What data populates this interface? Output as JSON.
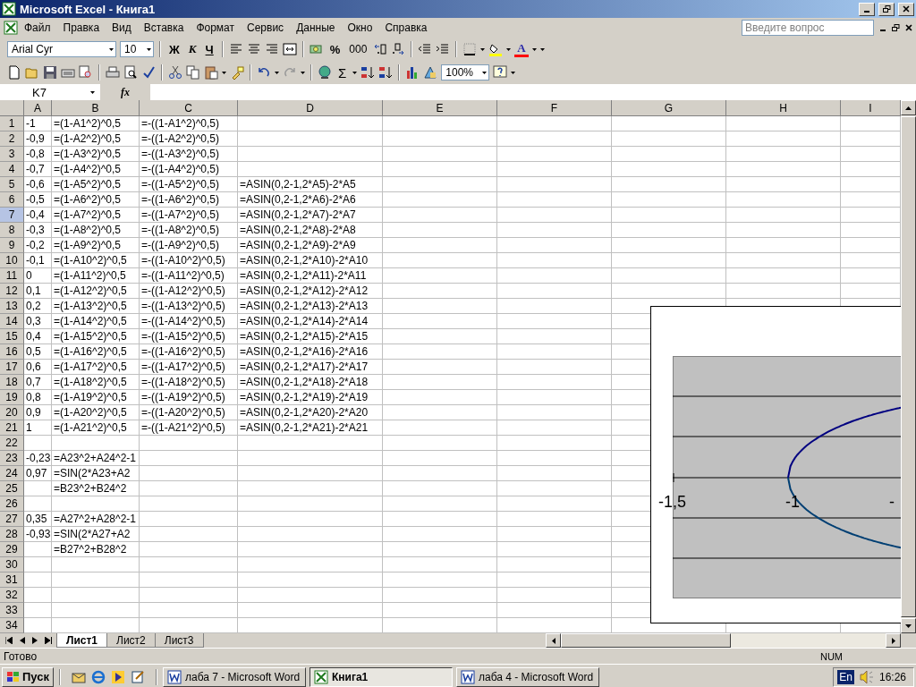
{
  "window": {
    "title": "Microsoft Excel - Книга1"
  },
  "menu": [
    "Файл",
    "Правка",
    "Вид",
    "Вставка",
    "Формат",
    "Сервис",
    "Данные",
    "Окно",
    "Справка"
  ],
  "help_box": {
    "placeholder": "Введите вопрос"
  },
  "formatting_toolbar": {
    "font": "Arial Cyr",
    "size": "10",
    "bold": "Ж",
    "italic": "К",
    "underline": "Ч",
    "percent": "%",
    "thousands": "000",
    "font_color": "A"
  },
  "standard_toolbar": {
    "autosum": "Σ",
    "zoom": "100%"
  },
  "formula_bar": {
    "name_box": "K7",
    "fx": "fx"
  },
  "columns": [
    "A",
    "B",
    "C",
    "D",
    "E",
    "F",
    "G",
    "H",
    "I"
  ],
  "rows": [
    {
      "number": "1",
      "selected": false,
      "cells": {
        "A": "-1",
        "B": "=(1-A1^2)^0,5",
        "C": "=-((1-A1^2)^0,5)"
      }
    },
    {
      "number": "2",
      "selected": false,
      "cells": {
        "A": "-0,9",
        "B": "=(1-A2^2)^0,5",
        "C": "=-((1-A2^2)^0,5)"
      }
    },
    {
      "number": "3",
      "selected": false,
      "cells": {
        "A": "-0,8",
        "B": "=(1-A3^2)^0,5",
        "C": "=-((1-A3^2)^0,5)"
      }
    },
    {
      "number": "4",
      "selected": false,
      "cells": {
        "A": "-0,7",
        "B": "=(1-A4^2)^0,5",
        "C": "=-((1-A4^2)^0,5)"
      }
    },
    {
      "number": "5",
      "selected": false,
      "cells": {
        "A": "-0,6",
        "B": "=(1-A5^2)^0,5",
        "C": "=-((1-A5^2)^0,5)",
        "D": "=ASIN(0,2-1,2*A5)-2*A5"
      }
    },
    {
      "number": "6",
      "selected": false,
      "cells": {
        "A": "-0,5",
        "B": "=(1-A6^2)^0,5",
        "C": "=-((1-A6^2)^0,5)",
        "D": "=ASIN(0,2-1,2*A6)-2*A6"
      }
    },
    {
      "number": "7",
      "selected": true,
      "cells": {
        "A": "-0,4",
        "B": "=(1-A7^2)^0,5",
        "C": "=-((1-A7^2)^0,5)",
        "D": "=ASIN(0,2-1,2*A7)-2*A7"
      }
    },
    {
      "number": "8",
      "selected": false,
      "cells": {
        "A": "-0,3",
        "B": "=(1-A8^2)^0,5",
        "C": "=-((1-A8^2)^0,5)",
        "D": "=ASIN(0,2-1,2*A8)-2*A8"
      }
    },
    {
      "number": "9",
      "selected": false,
      "cells": {
        "A": "-0,2",
        "B": "=(1-A9^2)^0,5",
        "C": "=-((1-A9^2)^0,5)",
        "D": "=ASIN(0,2-1,2*A9)-2*A9"
      }
    },
    {
      "number": "10",
      "selected": false,
      "cells": {
        "A": "-0,1",
        "B": "=(1-A10^2)^0,5",
        "C": "=-((1-A10^2)^0,5)",
        "D": "=ASIN(0,2-1,2*A10)-2*A10"
      }
    },
    {
      "number": "11",
      "selected": false,
      "cells": {
        "A": "0",
        "B": "=(1-A11^2)^0,5",
        "C": "=-((1-A11^2)^0,5)",
        "D": "=ASIN(0,2-1,2*A11)-2*A11"
      }
    },
    {
      "number": "12",
      "selected": false,
      "cells": {
        "A": "0,1",
        "B": "=(1-A12^2)^0,5",
        "C": "=-((1-A12^2)^0,5)",
        "D": "=ASIN(0,2-1,2*A12)-2*A12"
      }
    },
    {
      "number": "13",
      "selected": false,
      "cells": {
        "A": "0,2",
        "B": "=(1-A13^2)^0,5",
        "C": "=-((1-A13^2)^0,5)",
        "D": "=ASIN(0,2-1,2*A13)-2*A13"
      }
    },
    {
      "number": "14",
      "selected": false,
      "cells": {
        "A": "0,3",
        "B": "=(1-A14^2)^0,5",
        "C": "=-((1-A14^2)^0,5)",
        "D": "=ASIN(0,2-1,2*A14)-2*A14"
      }
    },
    {
      "number": "15",
      "selected": false,
      "cells": {
        "A": "0,4",
        "B": "=(1-A15^2)^0,5",
        "C": "=-((1-A15^2)^0,5)",
        "D": "=ASIN(0,2-1,2*A15)-2*A15"
      }
    },
    {
      "number": "16",
      "selected": false,
      "cells": {
        "A": "0,5",
        "B": "=(1-A16^2)^0,5",
        "C": "=-((1-A16^2)^0,5)",
        "D": "=ASIN(0,2-1,2*A16)-2*A16"
      }
    },
    {
      "number": "17",
      "selected": false,
      "cells": {
        "A": "0,6",
        "B": "=(1-A17^2)^0,5",
        "C": "=-((1-A17^2)^0,5)",
        "D": "=ASIN(0,2-1,2*A17)-2*A17"
      }
    },
    {
      "number": "18",
      "selected": false,
      "cells": {
        "A": "0,7",
        "B": "=(1-A18^2)^0,5",
        "C": "=-((1-A18^2)^0,5)",
        "D": "=ASIN(0,2-1,2*A18)-2*A18"
      }
    },
    {
      "number": "19",
      "selected": false,
      "cells": {
        "A": "0,8",
        "B": "=(1-A19^2)^0,5",
        "C": "=-((1-A19^2)^0,5)",
        "D": "=ASIN(0,2-1,2*A19)-2*A19"
      }
    },
    {
      "number": "20",
      "selected": false,
      "cells": {
        "A": "0,9",
        "B": "=(1-A20^2)^0,5",
        "C": "=-((1-A20^2)^0,5)",
        "D": "=ASIN(0,2-1,2*A20)-2*A20"
      }
    },
    {
      "number": "21",
      "selected": false,
      "cells": {
        "A": "1",
        "B": "=(1-A21^2)^0,5",
        "C": "=-((1-A21^2)^0,5)",
        "D": "=ASIN(0,2-1,2*A21)-2*A21"
      }
    },
    {
      "number": "22",
      "selected": false
    },
    {
      "number": "23",
      "selected": false,
      "cells": {
        "A": "-0,23",
        "B": "=A23^2+A24^2-1"
      }
    },
    {
      "number": "24",
      "selected": false,
      "cells": {
        "A": "0,97",
        "B": "=SIN(2*A23+A2"
      }
    },
    {
      "number": "25",
      "selected": false,
      "cells": {
        "B": "=B23^2+B24^2"
      }
    },
    {
      "number": "26",
      "selected": false
    },
    {
      "number": "27",
      "selected": false,
      "cells": {
        "A": "0,35",
        "B": "=A27^2+A28^2-1"
      }
    },
    {
      "number": "28",
      "selected": false,
      "cells": {
        "A": "-0,93",
        "B": "=SIN(2*A27+A2"
      }
    },
    {
      "number": "29",
      "selected": false,
      "cells": {
        "B": "=B27^2+B28^2"
      }
    },
    {
      "number": "30",
      "selected": false
    },
    {
      "number": "31",
      "selected": false
    },
    {
      "number": "32",
      "selected": false
    },
    {
      "number": "33",
      "selected": false
    },
    {
      "number": "34",
      "selected": false
    }
  ],
  "chart": {
    "x_axis_labels": [
      "-1,5",
      "-1",
      "-"
    ]
  },
  "sheet_tabs": [
    {
      "label": "Лист1",
      "selected": true
    },
    {
      "label": "Лист2",
      "selected": false
    },
    {
      "label": "Лист3",
      "selected": false
    }
  ],
  "status_bar": {
    "text": "Готово",
    "indicator": "NUM"
  },
  "taskbar": {
    "start": "Пуск",
    "tasks": [
      {
        "label": "лаба 7 - Microsoft Word",
        "selected": false,
        "kind": "word"
      },
      {
        "label": "Книга1",
        "selected": true,
        "kind": "excel"
      },
      {
        "label": "лаба 4 - Microsoft Word",
        "selected": false,
        "kind": "word"
      }
    ],
    "language": "En",
    "clock": "16:26"
  }
}
